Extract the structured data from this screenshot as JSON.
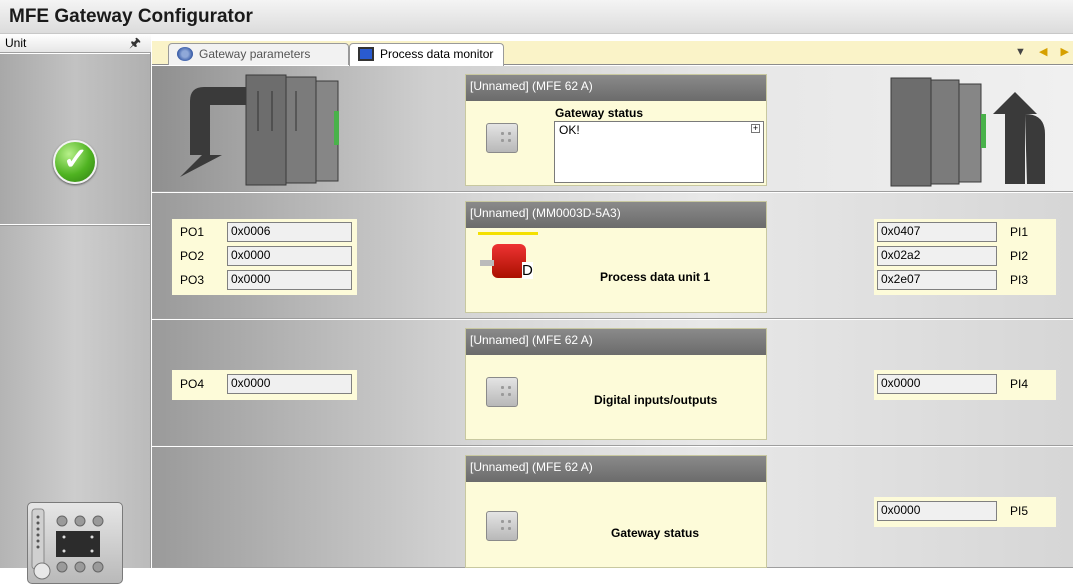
{
  "app": {
    "title": "MFE Gateway Configurator"
  },
  "unit_pane": {
    "label": "Unit",
    "pin_icon": "pin-icon"
  },
  "tabs": [
    {
      "label": "Gateway parameters",
      "icon": "gear-icon",
      "active": false
    },
    {
      "label": "Process data monitor",
      "icon": "monitor-icon",
      "active": true
    }
  ],
  "rows": {
    "gateway": {
      "header": "[Unnamed] (MFE 62 A)",
      "title": "Gateway status",
      "status_text": "OK!",
      "expand": "+"
    },
    "pdu": {
      "header": "[Unnamed] (MM0003D-5A3)",
      "title": "Process data unit 1",
      "motor_letter": "D",
      "outputs": [
        {
          "label": "PO1",
          "value": "0x0006"
        },
        {
          "label": "PO2",
          "value": "0x0000"
        },
        {
          "label": "PO3",
          "value": "0x0000"
        }
      ],
      "inputs": [
        {
          "label": "PI1",
          "value": "0x0407"
        },
        {
          "label": "PI2",
          "value": "0x02a2"
        },
        {
          "label": "PI3",
          "value": "0x2e07"
        }
      ]
    },
    "dio": {
      "header": "[Unnamed] (MFE 62 A)",
      "title": "Digital inputs/outputs",
      "outputs": [
        {
          "label": "PO4",
          "value": "0x0000"
        }
      ],
      "inputs": [
        {
          "label": "PI4",
          "value": "0x0000"
        }
      ]
    },
    "gwstatus": {
      "header": "[Unnamed] (MFE 62 A)",
      "title": "Gateway status",
      "inputs": [
        {
          "label": "PI5",
          "value": "0x0000"
        }
      ]
    }
  },
  "colors": {
    "panel_bg": "#fdfbd9",
    "header_bg": "#7a7a7a",
    "ok_green": "#4fb321"
  }
}
